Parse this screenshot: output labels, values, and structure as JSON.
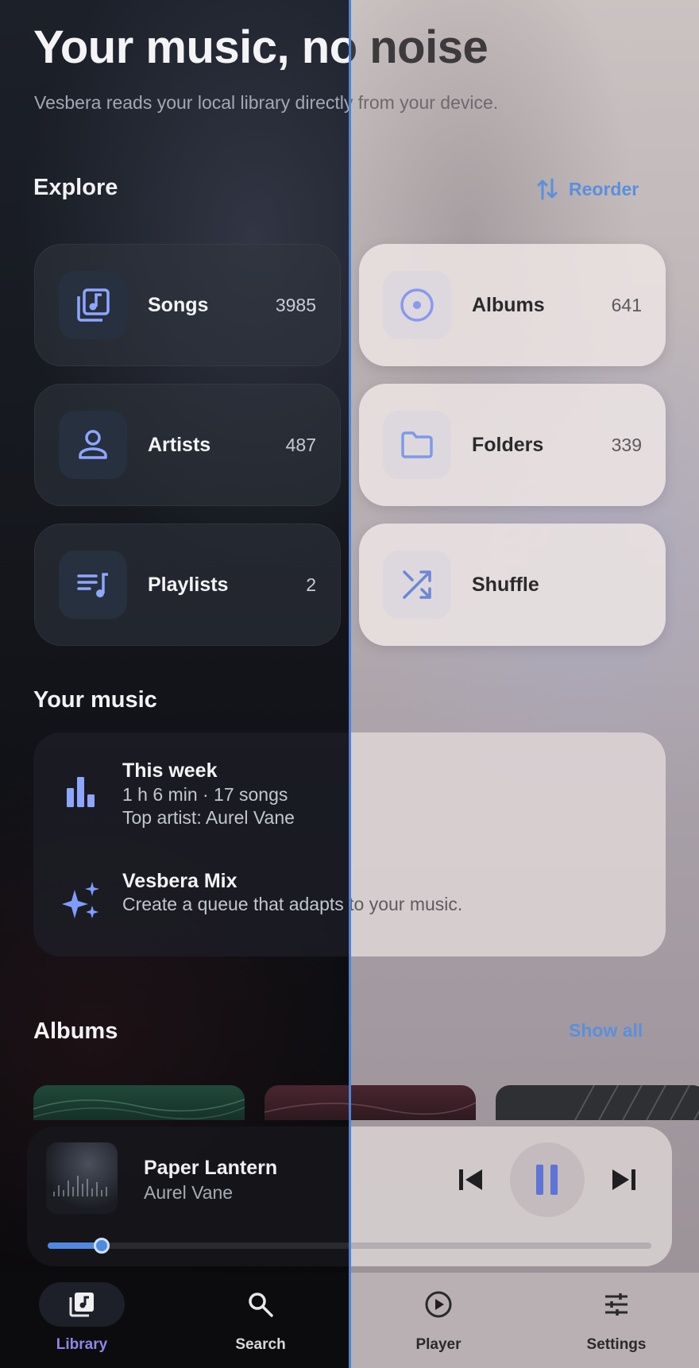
{
  "header": {
    "title": "Your music, no noise",
    "subtitle": "Vesbera reads your local library directly from your device."
  },
  "explore": {
    "title": "Explore",
    "reorder_label": "Reorder",
    "tiles": [
      {
        "label": "Songs",
        "count": "3985",
        "icon": "library-music-icon"
      },
      {
        "label": "Albums",
        "count": "641",
        "icon": "album-disc-icon"
      },
      {
        "label": "Artists",
        "count": "487",
        "icon": "person-icon"
      },
      {
        "label": "Folders",
        "count": "339",
        "icon": "folder-icon"
      },
      {
        "label": "Playlists",
        "count": "2",
        "icon": "playlist-icon"
      },
      {
        "label": "Shuffle",
        "count": "",
        "icon": "shuffle-icon"
      }
    ]
  },
  "your_music": {
    "title": "Your music",
    "this_week": {
      "title": "This week",
      "line1": "1 h 6 min · 17 songs",
      "line2": "Top artist: Aurel Vane",
      "icon": "bar-chart-icon"
    },
    "mix": {
      "title": "Vesbera Mix",
      "line1": "Create a queue that adapts to your music.",
      "icon": "sparkle-icon"
    }
  },
  "albums": {
    "title": "Albums",
    "show_all_label": "Show all"
  },
  "player": {
    "title": "Paper Lantern",
    "artist": "Aurel Vane",
    "progress": 0.09,
    "state": "playing"
  },
  "nav": {
    "items": [
      {
        "label": "Library",
        "icon": "library-icon",
        "active": true
      },
      {
        "label": "Search",
        "icon": "search-icon",
        "active": false
      },
      {
        "label": "Player",
        "icon": "play-circle-icon",
        "active": false
      },
      {
        "label": "Settings",
        "icon": "sliders-icon",
        "active": false
      }
    ]
  },
  "colors": {
    "accent": "#5b8fdc",
    "icon_accent": "#8fa6ff",
    "active_nav": "#8f86e8",
    "divider": "#4d84d6"
  }
}
